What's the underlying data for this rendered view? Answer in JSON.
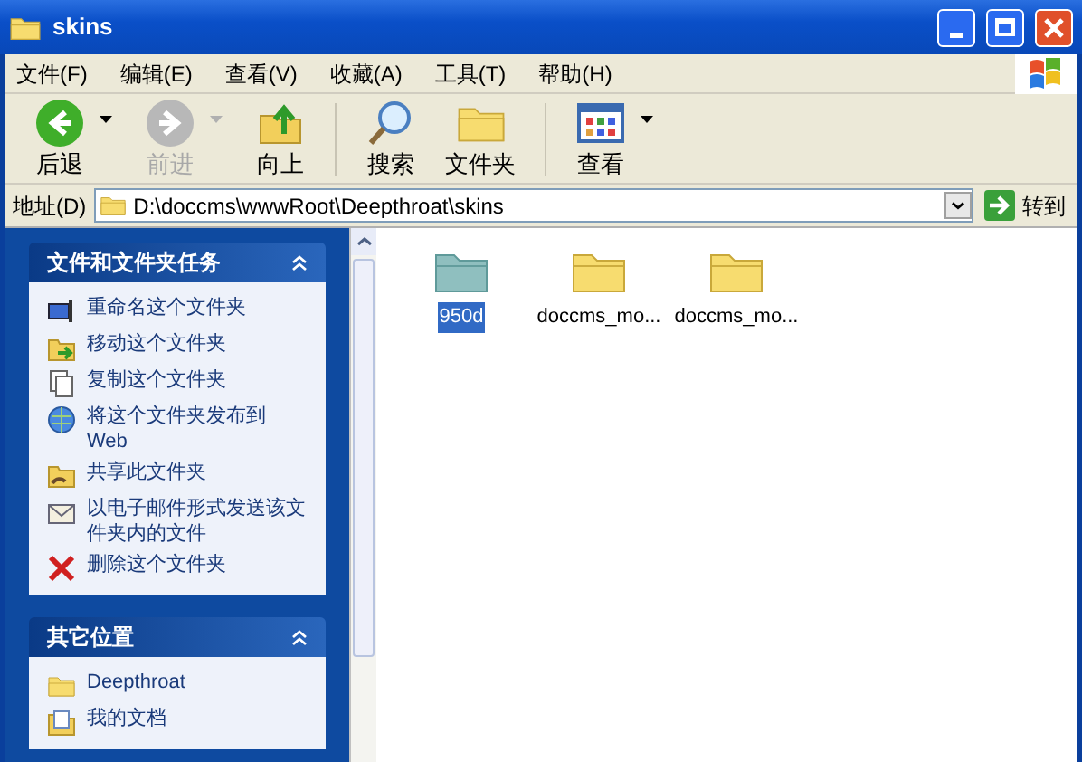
{
  "window": {
    "title": "skins"
  },
  "menu": [
    {
      "label": "文件(F)"
    },
    {
      "label": "编辑(E)"
    },
    {
      "label": "查看(V)"
    },
    {
      "label": "收藏(A)"
    },
    {
      "label": "工具(T)"
    },
    {
      "label": "帮助(H)"
    }
  ],
  "toolbar": [
    {
      "kind": "back",
      "label": "后退",
      "disabled": false,
      "dropdown": true
    },
    {
      "kind": "forward",
      "label": "前进",
      "disabled": true,
      "dropdown": true
    },
    {
      "kind": "up",
      "label": "向上",
      "disabled": false,
      "dropdown": false
    },
    {
      "kind": "search",
      "label": "搜索",
      "disabled": false,
      "dropdown": false
    },
    {
      "kind": "folders",
      "label": "文件夹",
      "disabled": false,
      "dropdown": false
    },
    {
      "kind": "views",
      "label": "查看",
      "disabled": false,
      "dropdown": true
    }
  ],
  "address": {
    "label": "地址(D)",
    "value": "D:\\doccms\\wwwRoot\\Deepthroat\\skins",
    "go": "转到"
  },
  "sidebar": {
    "panels": [
      {
        "title": "文件和文件夹任务",
        "expanded": true,
        "items": [
          {
            "kind": "rename",
            "label": "重命名这个文件夹"
          },
          {
            "kind": "move",
            "label": "移动这个文件夹"
          },
          {
            "kind": "copy",
            "label": "复制这个文件夹"
          },
          {
            "kind": "publish",
            "label": "将这个文件夹发布到 Web"
          },
          {
            "kind": "share",
            "label": "共享此文件夹"
          },
          {
            "kind": "email",
            "label": "以电子邮件形式发送该文件夹内的文件"
          },
          {
            "kind": "delete",
            "label": "删除这个文件夹"
          }
        ]
      },
      {
        "title": "其它位置",
        "expanded": true,
        "items": [
          {
            "kind": "folder",
            "label": "Deepthroat"
          },
          {
            "kind": "documents",
            "label": "我的文档"
          }
        ]
      }
    ]
  },
  "files": [
    {
      "name": "950d",
      "selected": true
    },
    {
      "name": "doccms_mo...",
      "selected": false
    },
    {
      "name": "doccms_mo...",
      "selected": false
    }
  ]
}
